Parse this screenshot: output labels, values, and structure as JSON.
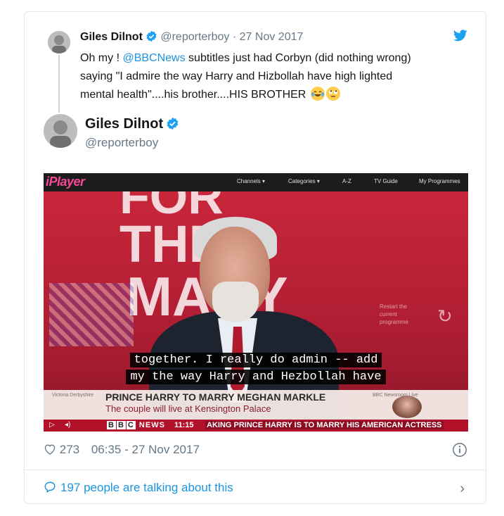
{
  "quoted": {
    "name": "Giles Dilnot",
    "handle": "@reporterboy",
    "separator": "·",
    "date": "27 Nov 2017",
    "text_before_mention": "Oh my ! ",
    "mention": "@BBCNews",
    "text_after_mention_1": " subtitles just had Corbyn (did nothing wrong)",
    "text_line_2": "saying \"I admire the way Harry and Hizbollah have high lighted",
    "text_line_3": "mental health\"....his brother....HIS BROTHER "
  },
  "author": {
    "name": "Giles Dilnot",
    "handle": "@reporterboy"
  },
  "media": {
    "logo": "iPlayer",
    "nav": [
      "Channels ▾",
      "Categories ▾",
      "A-Z",
      "TV Guide",
      "My Programmes"
    ],
    "backdrop_lines": [
      "FOR",
      "THE",
      "MANY"
    ],
    "restart_text": "Restart the current programme",
    "subtitle_line_1": "together. I really do admin -- add",
    "subtitle_line_2": "my the way Harry and Hezbollah have",
    "caption_small_left": "Victoria Derbyshire",
    "caption_small_right": "BBC Newsroom Live",
    "headline": "PRINCE HARRY TO MARRY MEGHAN MARKLE",
    "subheadline": "The couple will live at Kensington Palace",
    "channel_letters": [
      "B",
      "B",
      "C"
    ],
    "channel_word": "NEWS",
    "clock": "11:15",
    "ticker": "AKING  PRINCE HARRY IS TO MARRY HIS AMERICAN ACTRESS"
  },
  "stats": {
    "likes": "273",
    "time": "06:35 - 27 Nov 2017"
  },
  "footer": {
    "talking": "197 people are talking about this",
    "chevron": "›"
  },
  "icons": [
    "verified-badge-icon",
    "twitter-bird-icon",
    "heart-icon",
    "info-icon",
    "speech-bubble-icon",
    "chevron-right-icon",
    "tears-of-joy-emoji",
    "eye-roll-emoji"
  ],
  "colors": {
    "link": "#1b95e0",
    "muted": "#657786",
    "verified": "#1da1f2",
    "iplayer_pink": "#f54997",
    "news_red": "#b3102a"
  }
}
